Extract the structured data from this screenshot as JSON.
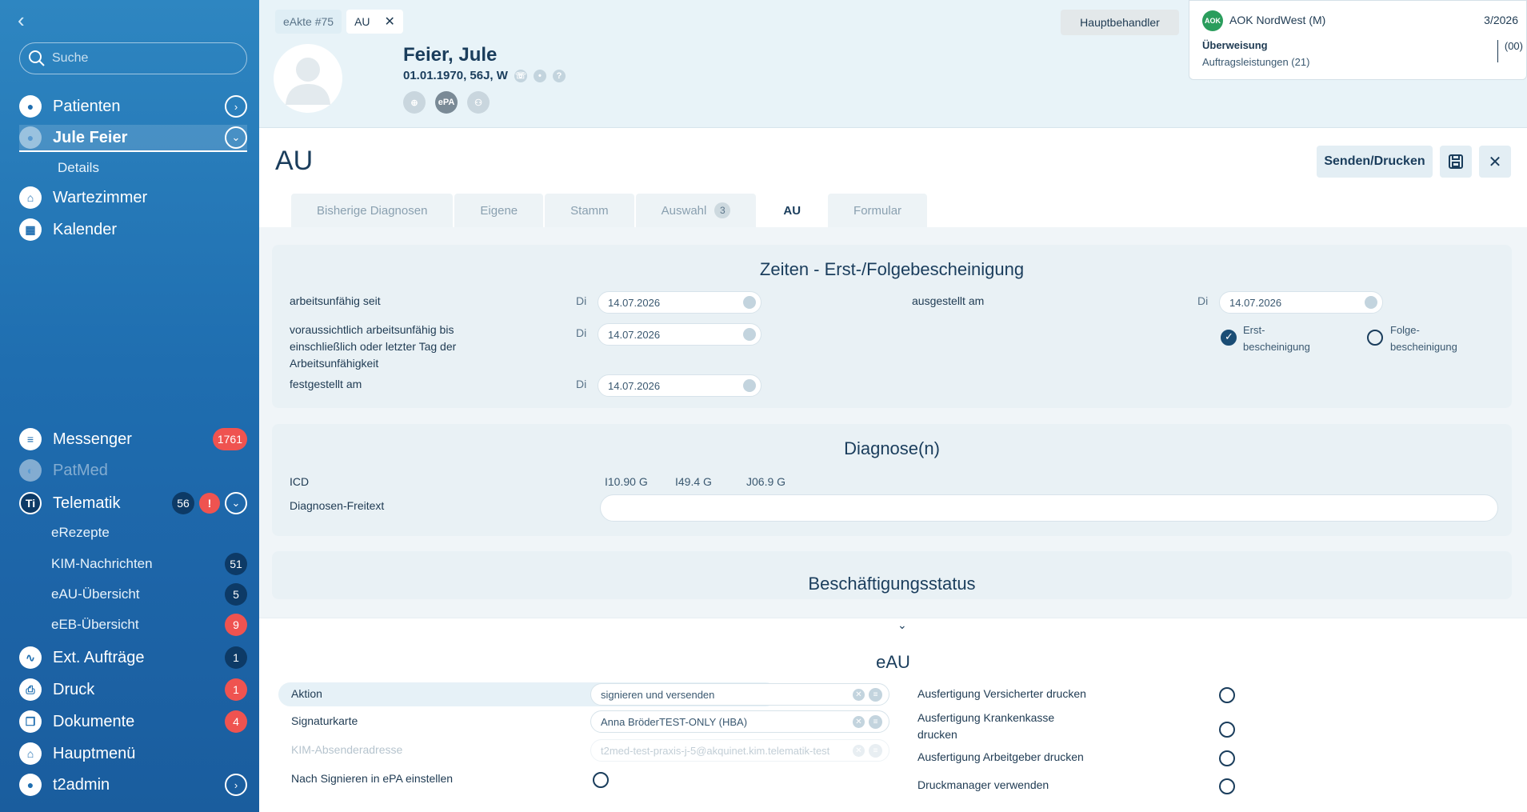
{
  "sidebar": {
    "search_placeholder": "Suche",
    "items": [
      {
        "label": "Patienten"
      },
      {
        "label": "Jule Feier"
      },
      {
        "label": "Details"
      },
      {
        "label": "Wartezimmer"
      },
      {
        "label": "Kalender"
      },
      {
        "label": "Messenger",
        "badge": "1761"
      },
      {
        "label": "PatMed"
      },
      {
        "label": "Telematik",
        "badge": "56",
        "icon_text": "Ti"
      },
      {
        "label": "eRezepte"
      },
      {
        "label": "KIM-Nachrichten",
        "badge": "51"
      },
      {
        "label": "eAU-Übersicht",
        "badge": "5"
      },
      {
        "label": "eEB-Übersicht",
        "badge": "9"
      },
      {
        "label": "Ext. Aufträge",
        "badge": "1"
      },
      {
        "label": "Druck",
        "badge": "1"
      },
      {
        "label": "Dokumente",
        "badge": "4"
      },
      {
        "label": "Hauptmenü"
      },
      {
        "label": "t2admin"
      }
    ]
  },
  "header": {
    "tabs": [
      {
        "label": "eAkte #75"
      },
      {
        "label": "AU"
      }
    ],
    "patient_name": "Feier,  Jule",
    "patient_dob": "01.01.1970, 56J, W",
    "badge_epa": "ePA",
    "hauptbehandler": "Hauptbehandler",
    "insurance": {
      "name": "AOK NordWest (M)",
      "logo": "AOK",
      "quarter": "3/2026",
      "type": "Überweisung",
      "detail": "Auftragsleistungen (21)",
      "code": "(00)"
    }
  },
  "main": {
    "title": "AU",
    "send_print": "Senden/Drucken",
    "tabs": [
      {
        "label": "Bisherige Diagnosen"
      },
      {
        "label": "Eigene"
      },
      {
        "label": "Stamm"
      },
      {
        "label": "Auswahl",
        "count": "3"
      },
      {
        "label": "AU"
      },
      {
        "label": "Formular"
      }
    ],
    "zeiten": {
      "title": "Zeiten - Erst-/Folgebescheinigung",
      "au_seit_label": "arbeitsunfähig seit",
      "au_seit_day": "Di",
      "au_seit_date": "14.07.2026",
      "voraus_label": "voraussichtlich arbeitsunfähig bis einschließlich oder letzter Tag der Arbeitsunfähigkeit",
      "voraus_day": "Di",
      "voraus_date": "14.07.2026",
      "festgestellt_label": "festgestellt am",
      "festgestellt_day": "Di",
      "festgestellt_date": "14.07.2026",
      "ausgestellt_label": "ausgestellt am",
      "ausgestellt_day": "Di",
      "ausgestellt_date": "14.07.2026",
      "erst_label": "Erst-\nbescheinigung",
      "folge_label": "Folge-\nbescheinigung"
    },
    "diagnose": {
      "title": "Diagnose(n)",
      "icd_label": "ICD",
      "icd_codes": [
        "I10.90 G",
        "I49.4 G",
        "J06.9 G"
      ],
      "freitext_label": "Diagnosen-Freitext",
      "freitext_value": ""
    },
    "beschaeftigung_title": "Beschäftigungsstatus",
    "eau": {
      "title": "eAU",
      "aktion_label": "Aktion",
      "aktion_value": "signieren und versenden",
      "signatur_label": "Signaturkarte",
      "signatur_value": "Anna BröderTEST-ONLY (HBA)",
      "kim_label": "KIM-Absenderadresse",
      "kim_value": "t2med-test-praxis-j-5@akquinet.kim.telematik-test",
      "epa_label": "Nach Signieren in ePA einstellen",
      "vers_label": "Ausfertigung Versicherter drucken",
      "kk_label": "Ausfertigung Krankenkasse drucken",
      "ag_label": "Ausfertigung Arbeitgeber drucken",
      "dm_label": "Druckmanager verwenden"
    }
  },
  "colors": {
    "sidebar_top": "#2e86c1",
    "sidebar_bottom": "#1a5d9e",
    "badge_red": "#ef5350",
    "badge_navy": "#0d3a66",
    "text_navy": "#1a3d5c"
  }
}
